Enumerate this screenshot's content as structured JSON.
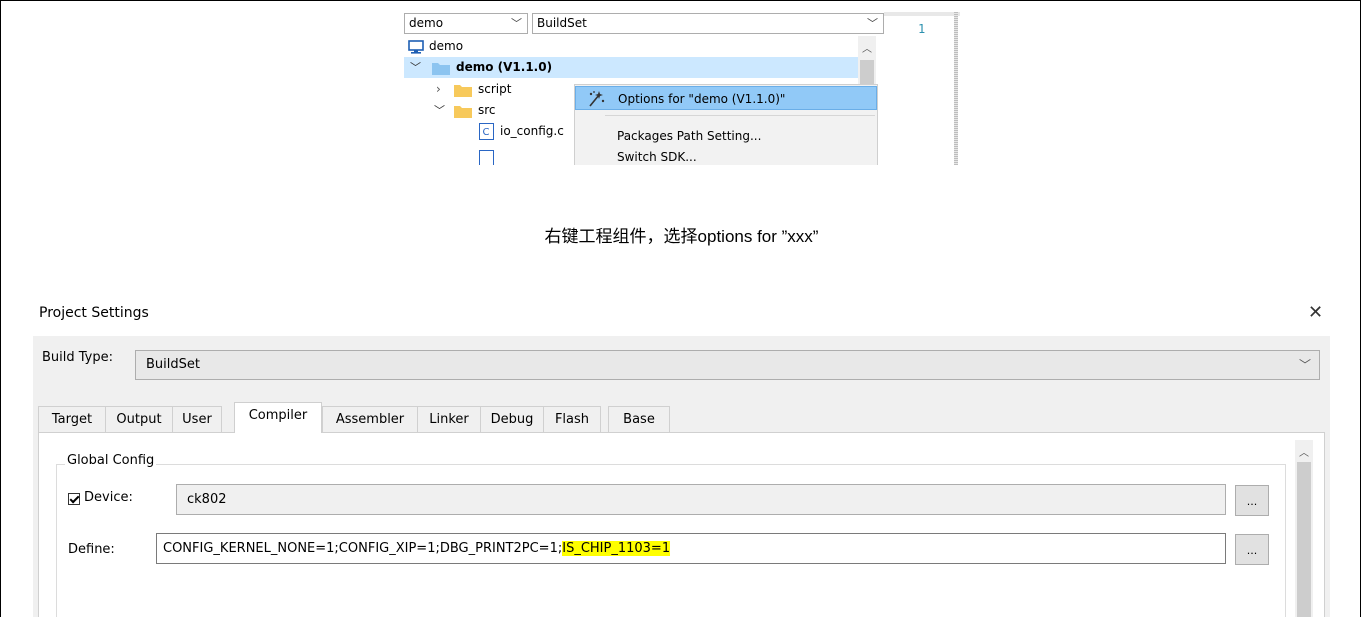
{
  "top_screenshot": {
    "project_combo": "demo",
    "buildset_combo": "BuildSet",
    "editor_line_number": "1",
    "tree": {
      "workspace": "demo",
      "project": "demo (V1.1.0)",
      "script_folder": "script",
      "src_folder": "src",
      "file": "io_config.c"
    },
    "context_menu": {
      "options_item": "Options for \"demo (V1.1.0)\"",
      "packages_item": "Packages Path Setting...",
      "switch_sdk_item": "Switch SDK..."
    }
  },
  "caption": "右键工程组件，选择options for ”xxx”",
  "dialog": {
    "title": "Project Settings",
    "close": "✕",
    "build_type_label": "Build Type:",
    "build_type_value": "BuildSet",
    "tabs": [
      {
        "label": "Target"
      },
      {
        "label": "Output"
      },
      {
        "label": "User"
      },
      {
        "label": "Compiler"
      },
      {
        "label": "Assembler"
      },
      {
        "label": "Linker"
      },
      {
        "label": "Debug"
      },
      {
        "label": "Flash"
      },
      {
        "label": "Base"
      }
    ],
    "active_tab": "Compiler",
    "global_config_label": "Global Config",
    "device_label": "Device:",
    "device_checked": true,
    "device_value": "ck802",
    "define_label": "Define:",
    "define_value_plain": "CONFIG_KERNEL_NONE=1;CONFIG_XIP=1;DBG_PRINT2PC=1;",
    "define_value_highlight": "IS_CHIP_1103=1",
    "browse_label": "...",
    "highlight_color": "#ffff00",
    "selection_color": "#cce8ff",
    "menu_highlight_color": "#91c9f7"
  }
}
